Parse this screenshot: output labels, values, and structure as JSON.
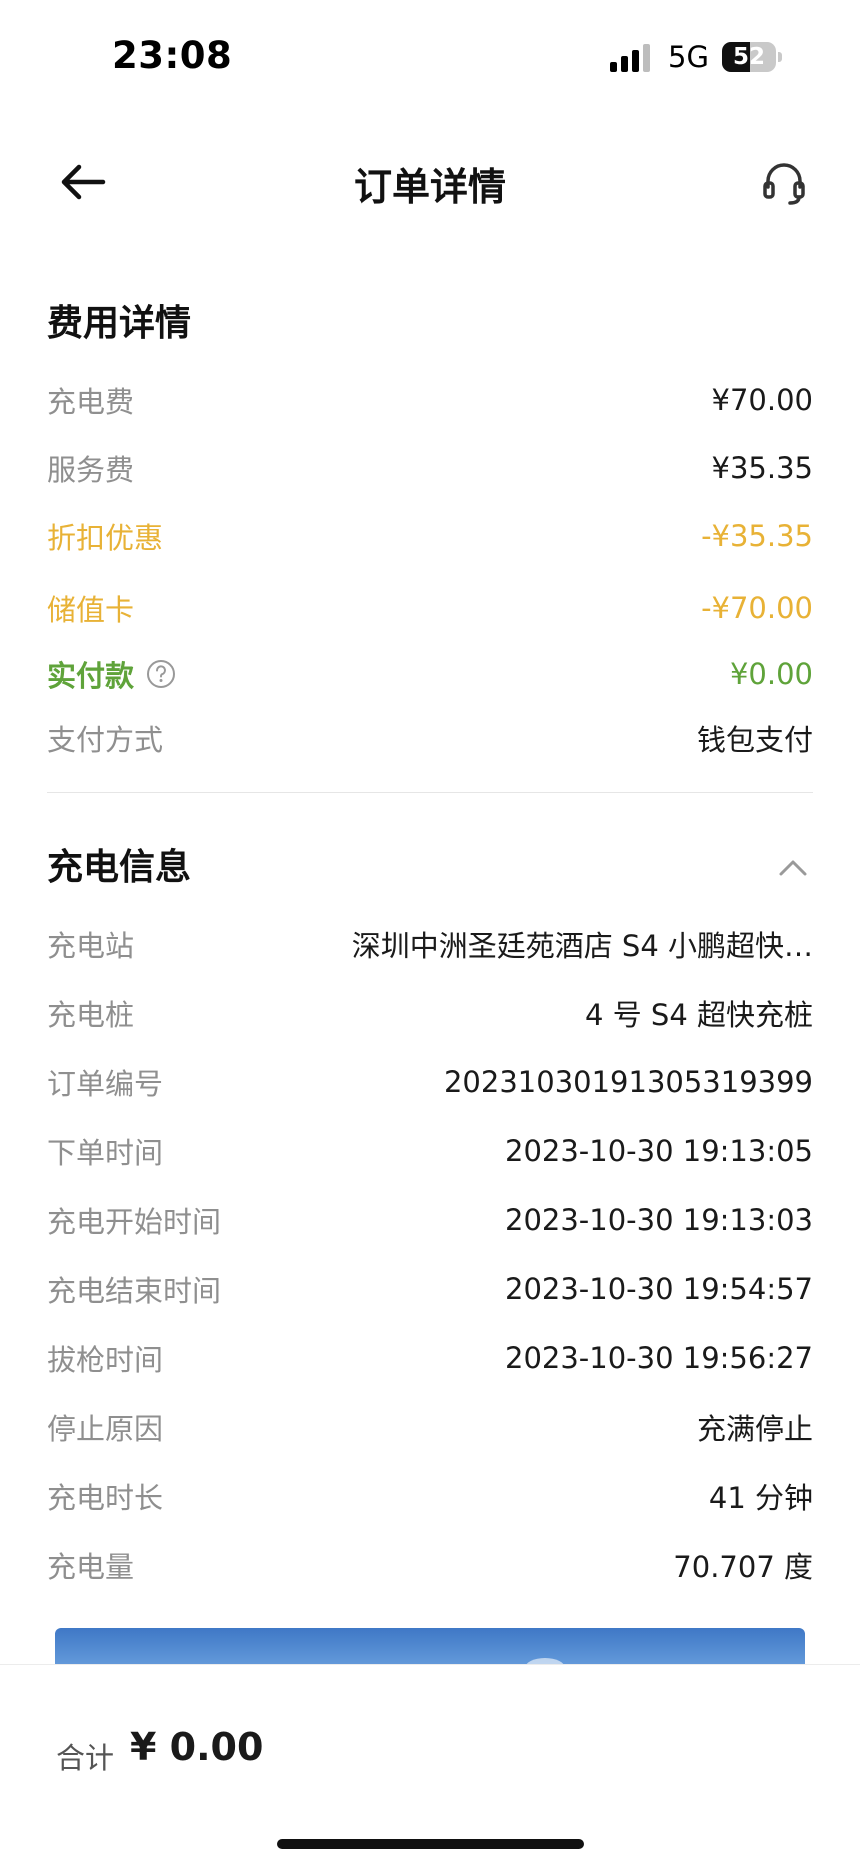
{
  "status_bar": {
    "time": "23:08",
    "network": "5G",
    "battery_percent": "52",
    "battery_level": 0.52
  },
  "nav": {
    "title": "订单详情",
    "back_icon": "arrow-left-icon",
    "support_icon": "headset-icon"
  },
  "fee_section": {
    "title": "费用详情",
    "rows": [
      {
        "label": "充电费",
        "value": "¥70.00"
      },
      {
        "label": "服务费",
        "value": "¥35.35"
      },
      {
        "label": "折扣优惠",
        "value": "-¥35.35"
      },
      {
        "label": "储值卡",
        "value": "-¥70.00"
      },
      {
        "label": "实付款",
        "value": "¥0.00"
      },
      {
        "label": "支付方式",
        "value": "钱包支付"
      }
    ]
  },
  "charge_section": {
    "title": "充电信息",
    "rows": [
      {
        "label": "充电站",
        "value": "深圳中洲圣廷苑酒店 S4 小鹏超快…"
      },
      {
        "label": "充电桩",
        "value": "4 号 S4 超快充桩"
      },
      {
        "label": "订单编号",
        "value": "20231030191305319399"
      },
      {
        "label": "下单时间",
        "value": "2023-10-30 19:13:05"
      },
      {
        "label": "充电开始时间",
        "value": "2023-10-30 19:13:03"
      },
      {
        "label": "充电结束时间",
        "value": "2023-10-30 19:54:57"
      },
      {
        "label": "拔枪时间",
        "value": "2023-10-30 19:56:27"
      },
      {
        "label": "停止原因",
        "value": "充满停止"
      },
      {
        "label": "充电时长",
        "value": "41 分钟"
      },
      {
        "label": "充电量",
        "value": "70.707 度"
      }
    ]
  },
  "footer": {
    "total_label": "合计",
    "total_value": "¥ 0.00"
  },
  "colors": {
    "discount": "#e8b236",
    "paid": "#5fa33a",
    "label": "#8f8f8f"
  }
}
